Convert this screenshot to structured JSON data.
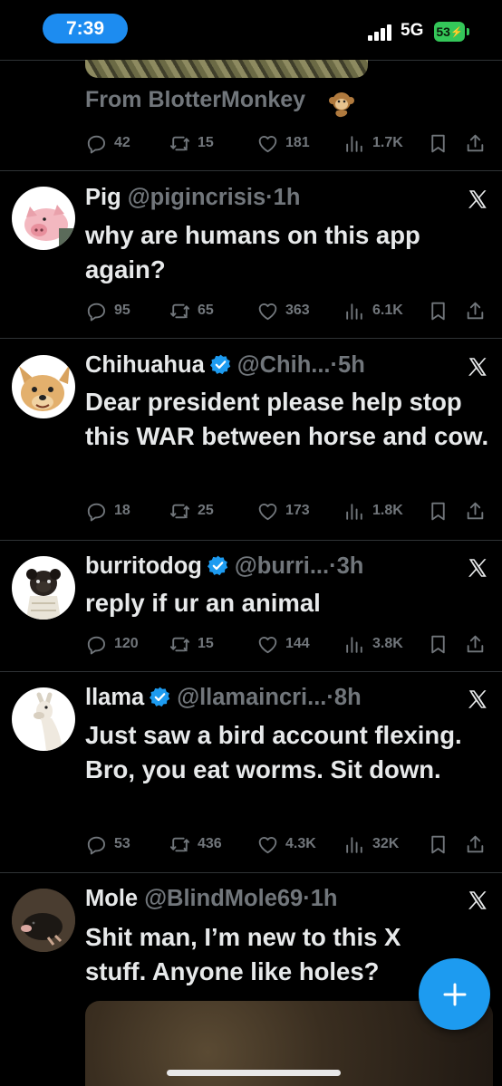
{
  "status_bar": {
    "time": "7:39",
    "network": "5G",
    "battery": "53"
  },
  "previous_tweet": {
    "source_text": "From BlotterMonkey",
    "source_emoji": "monkey",
    "replies": "42",
    "reposts": "15",
    "likes": "181",
    "views": "1.7K"
  },
  "tweets": [
    {
      "name": "Pig",
      "verified": false,
      "handle": "@pigincrisis",
      "dot": "·",
      "age": "1h",
      "text": "why are humans on this app again?",
      "replies": "95",
      "reposts": "65",
      "likes": "363",
      "views": "6.1K"
    },
    {
      "name": "Chihuahua",
      "verified": true,
      "handle": "@Chih...",
      "dot": "·",
      "age": "5h",
      "text": "Dear president please help stop this WAR between horse and cow.",
      "replies": "18",
      "reposts": "25",
      "likes": "173",
      "views": "1.8K"
    },
    {
      "name": "burritodog",
      "verified": true,
      "handle": "@burri...",
      "dot": "·",
      "age": "3h",
      "text": "reply if ur an animal",
      "replies": "120",
      "reposts": "15",
      "likes": "144",
      "views": "3.8K"
    },
    {
      "name": "llama",
      "verified": true,
      "handle": "@llamaincri...",
      "dot": "·",
      "age": "8h",
      "text": "Just saw a bird account flexing. Bro, you eat worms. Sit down.",
      "replies": "53",
      "reposts": "436",
      "likes": "4.3K",
      "views": "32K"
    },
    {
      "name": "Mole",
      "verified": false,
      "handle": "@BlindMole69",
      "dot": "·",
      "age": "1h",
      "text": "Shit man, I’m new to this X stuff. Anyone like holes?"
    }
  ],
  "icons": {
    "reply": "reply-icon",
    "repost": "repost-icon",
    "like": "heart-icon",
    "views": "views-icon",
    "bookmark": "bookmark-icon",
    "share": "share-icon",
    "more": "x-close-icon",
    "compose": "plus-icon"
  },
  "colors": {
    "background": "#000000",
    "accent": "#1d9bf0",
    "muted": "#71767b",
    "text": "#e7e9ea",
    "battery": "#34c759"
  }
}
